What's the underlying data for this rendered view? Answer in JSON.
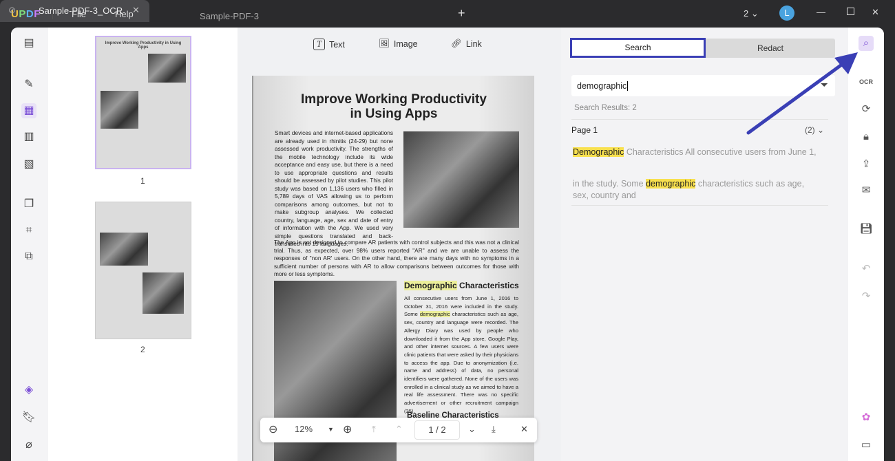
{
  "titlebar": {
    "logo": [
      "U",
      "P",
      "D",
      "F"
    ],
    "menu": [
      "File",
      "Help"
    ],
    "tabs": [
      "Sample-PDF-3",
      "Sample-PDF-3_OCR"
    ],
    "page_count": "2",
    "avatar": "L"
  },
  "toolbar": {
    "text": "Text",
    "image": "Image",
    "link": "Link"
  },
  "thumbnails": [
    {
      "label": "1",
      "title": "Improve Working Productivity in Using Apps"
    },
    {
      "label": "2"
    }
  ],
  "document": {
    "title1": "Improve Working Productivity",
    "title2": "in Using Apps",
    "para1": "Smart devices and internet-based applications are already used in rhinitis (24-29) but none assessed work productivity. The strengths of the mobile technology include its wide acceptance and easy use, but there is a need to use appropriate questions and results should be assessed by pilot studies. This pilot study was based on 1,136 users who filled in 5,789 days of VAS allowing us to perform comparisons among outcomes, but not to make subgroup analyses. We collected country, language, age, sex and date of entry of information with the App. We used very simple questions translated and back-translated into 15 languages.",
    "para2": "The App is not designed to compare AR patients with control subjects and this was not a clinical trial. Thus, as expected, over 98% users reported \"AR\" and we are unable to assess the responses of \"non AR' users. On the other hand, there are many days with no symptoms in a sufficient number of persons with AR to allow comparisons between outcomes for those with more or less symptoms.",
    "h2a": "Demographic",
    "h2b": " Characteristics",
    "para3a": "All consecutive users from June 1, 2016 to October 31, 2016 were included in the study. Some ",
    "para3hl": "demographic",
    "para3b": " characteristics such as age, sex, country and language were recorded. The Allergy Diary was used by people who downloaded it from the App store, Google Play, and other internet sources. A few users were clinic patients that were asked by their physicians to access the app. Due to anonymization (i.e. name and address) of data, no personal identifiers were gathered. None of the users was enrolled in a clinical study as we aimed to have a real life assessment. There was no specific advertisement or other recruitment campaign (35).",
    "h3": "Baseline Characteristics"
  },
  "zoom": {
    "level": "12%",
    "page": "1 / 2"
  },
  "search_panel": {
    "tab_search": "Search",
    "tab_redact": "Redact",
    "query": "demographic",
    "results": "Search Results: 2",
    "page_label": "Page 1",
    "page_count": "(2)",
    "result1": {
      "hl": "Demographic",
      "rest": " Characteristics All consecutive users from June 1,"
    },
    "result2": {
      "pre": "in the study. Some ",
      "hl": "demographic",
      "rest": " characteristics such as age, sex, country and"
    }
  },
  "colors": {
    "accent": "#3a3fb5",
    "highlight": "#f8e04e"
  }
}
